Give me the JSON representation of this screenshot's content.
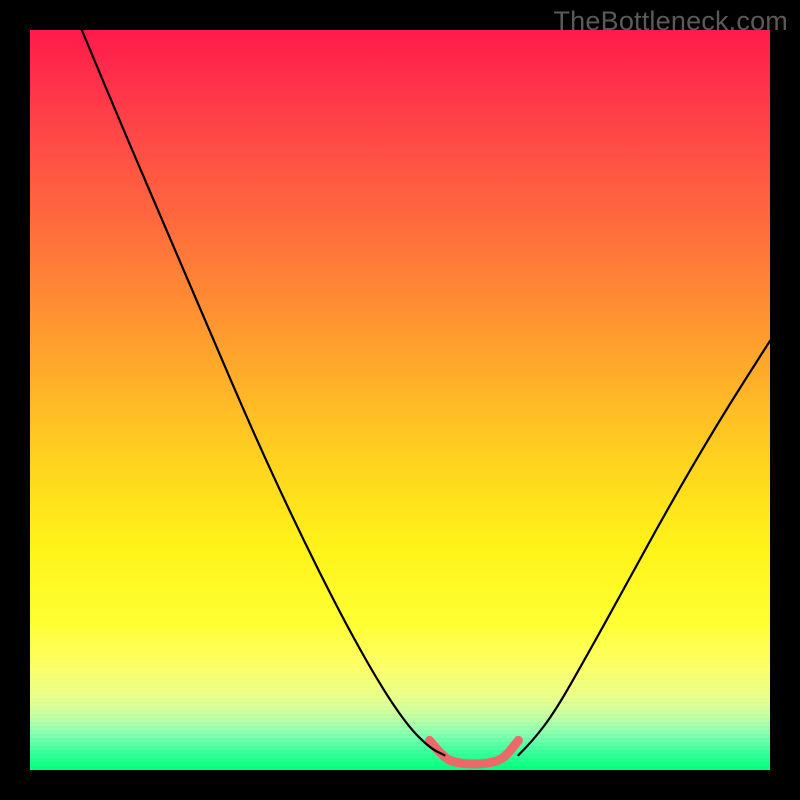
{
  "watermark": "TheBottleneck.com",
  "chart_data": {
    "type": "line",
    "title": "",
    "xlabel": "",
    "ylabel": "",
    "xlim": [
      0,
      100
    ],
    "ylim": [
      0,
      100
    ],
    "grid": false,
    "background_gradient": {
      "direction": "vertical",
      "stops": [
        {
          "pos": 0,
          "color": "#ff1a4a"
        },
        {
          "pos": 50,
          "color": "#ffd21f"
        },
        {
          "pos": 85,
          "color": "#fdff66"
        },
        {
          "pos": 100,
          "color": "#00ff7a"
        }
      ]
    },
    "series": [
      {
        "name": "left-curve",
        "stroke": "#000000",
        "width": 2.2,
        "x": [
          7,
          12,
          18,
          24,
          30,
          36,
          42,
          47,
          51,
          54,
          56
        ],
        "y": [
          100,
          88,
          74,
          60,
          46,
          33,
          21,
          12,
          6,
          3,
          2
        ]
      },
      {
        "name": "right-curve",
        "stroke": "#000000",
        "width": 2.2,
        "x": [
          66,
          68,
          71,
          75,
          80,
          86,
          93,
          100
        ],
        "y": [
          2,
          4,
          8,
          15,
          24,
          35,
          47,
          58
        ]
      },
      {
        "name": "valley-bottom",
        "stroke": "#ea6a6a",
        "width": 9,
        "linecap": "round",
        "x": [
          54,
          56,
          58,
          60,
          62,
          64,
          66
        ],
        "y": [
          4.0,
          1.5,
          0.9,
          0.8,
          0.9,
          1.5,
          4.0
        ]
      }
    ],
    "annotations": []
  }
}
